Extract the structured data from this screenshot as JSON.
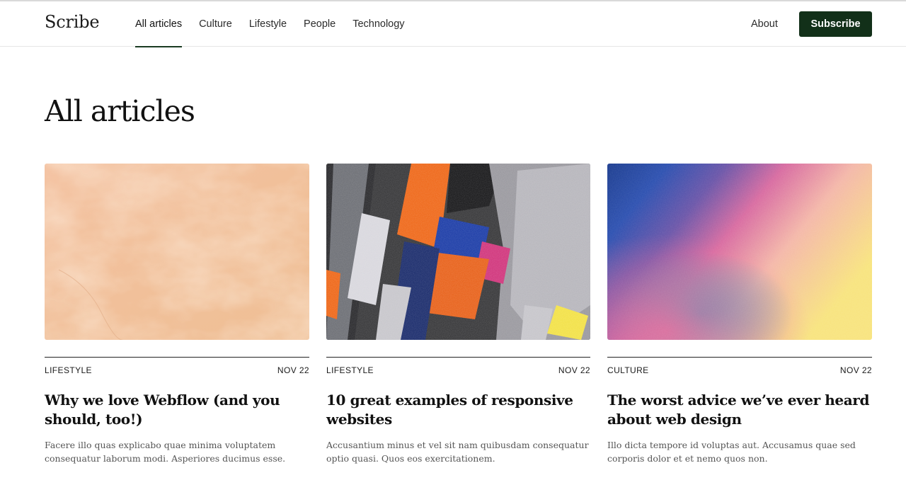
{
  "header": {
    "brand": "Scribe",
    "nav": [
      {
        "label": "All articles",
        "active": true
      },
      {
        "label": "Culture",
        "active": false
      },
      {
        "label": "Lifestyle",
        "active": false
      },
      {
        "label": "People",
        "active": false
      },
      {
        "label": "Technology",
        "active": false
      }
    ],
    "about": "About",
    "subscribe": "Subscribe"
  },
  "page": {
    "title": "All articles"
  },
  "articles": [
    {
      "category": "LIFESTYLE",
      "date": "NOV 22",
      "title": "Why we love Webflow (and you should, too!)",
      "excerpt": "Facere illo quas explicabo quae minima voluptatem consequatur laborum modi. Asperiores ducimus esse.",
      "image": "peach-marble-texture"
    },
    {
      "category": "LIFESTYLE",
      "date": "NOV 22",
      "title": "10 great examples of responsive websites",
      "excerpt": "Accusantium minus et vel sit nam quibusdam consequatur optio quasi. Quos eos exercitationem.",
      "image": "abstract-pastel-strokes"
    },
    {
      "category": "CULTURE",
      "date": "NOV 22",
      "title": "The worst advice we’ve ever heard about web design",
      "excerpt": "Illo dicta tempore id voluptas aut. Accusamus quae sed corporis dolor et et nemo quos non.",
      "image": "gradient-blue-pink-yellow"
    }
  ],
  "colors": {
    "accent": "#123019",
    "text": "#111111",
    "muted": "#555555"
  }
}
